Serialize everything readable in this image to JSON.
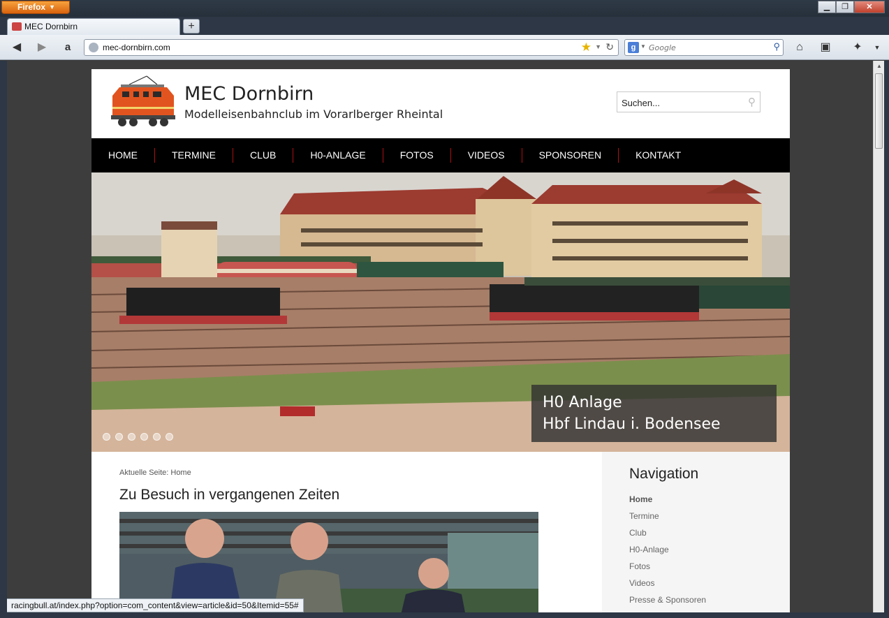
{
  "browser": {
    "menu_label": "Firefox",
    "tab_title": "MEC Dornbirn",
    "new_tab_label": "+",
    "url": "mec-dornbirn.com",
    "search_placeholder": "Google",
    "status_url": "racingbull.at/index.php?option=com_content&view=article&id=50&Itemid=55#",
    "icons": [
      "back-icon",
      "forward-icon",
      "amazon-icon",
      "globe-icon",
      "bookmark-star-icon",
      "reload-icon",
      "google-icon",
      "search-icon",
      "home-icon",
      "bookmarks-icon",
      "addon-icon",
      "menu-icon"
    ]
  },
  "site": {
    "title": "MEC Dornbirn",
    "subtitle": "Modelleisenbahnclub im Vorarlberger Rheintal",
    "search_value": "Suchen..."
  },
  "nav": {
    "items": [
      "HOME",
      "TERMINE",
      "CLUB",
      "H0-ANLAGE",
      "FOTOS",
      "VIDEOS",
      "SPONSOREN",
      "KONTAKT"
    ]
  },
  "slider": {
    "caption_line1": "H0 Anlage",
    "caption_line2": "Hbf Lindau i. Bodensee",
    "dot_count": 6
  },
  "content": {
    "breadcrumb": "Aktuelle Seite: Home",
    "article_title": "Zu Besuch in vergangenen Zeiten"
  },
  "sidebar": {
    "title": "Navigation",
    "items": [
      "Home",
      "Termine",
      "Club",
      "H0-Anlage",
      "Fotos",
      "Videos",
      "Presse & Sponsoren"
    ],
    "active": "Home"
  },
  "colors": {
    "nav_bg": "#000000",
    "nav_divider": "#aa1111",
    "sidebar_bg": "#f5f5f5",
    "firefox_orange": "#e8801f"
  }
}
